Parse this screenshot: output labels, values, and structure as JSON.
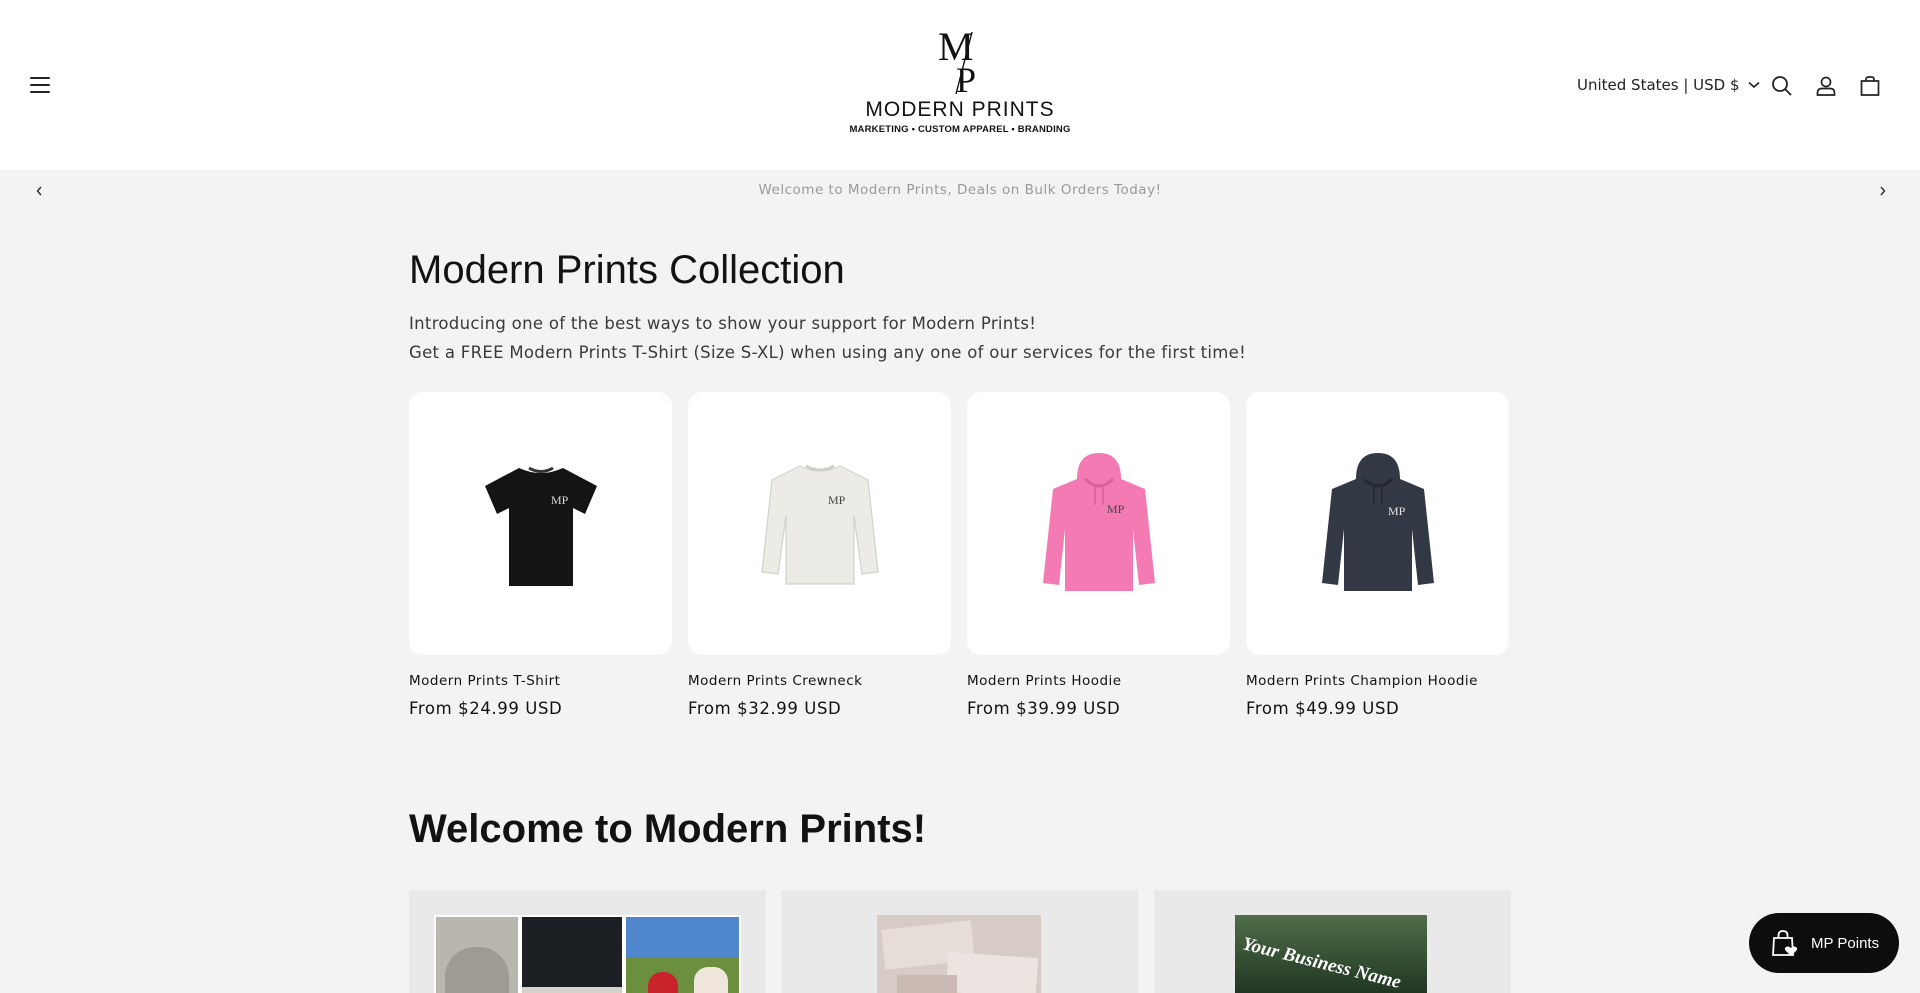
{
  "header": {
    "logo": {
      "monogram": "MP",
      "name": "MODERN PRINTS",
      "tagline": "MARKETING • CUSTOM APPAREL • BRANDING"
    },
    "locale_label": "United States | USD $",
    "icons": [
      "menu-icon",
      "chevron-down-icon",
      "search-icon",
      "account-icon",
      "cart-icon"
    ]
  },
  "announcement": {
    "text": "Welcome to Modern Prints, Deals on Bulk Orders Today!"
  },
  "collection": {
    "title": "Modern Prints Collection",
    "description_line1": "Introducing one of the best ways to show your support for Modern Prints!",
    "description_line2": "Get a FREE Modern Prints T-Shirt (Size S-XL) when using any one of our services for the first time!",
    "products": [
      {
        "name": "Modern Prints T-Shirt",
        "price": "From $24.99 USD",
        "color": "#141414"
      },
      {
        "name": "Modern Prints Crewneck",
        "price": "From $32.99 USD",
        "color": "#ecebe6"
      },
      {
        "name": "Modern Prints Hoodie",
        "price": "From $39.99 USD",
        "color": "#f37ab2"
      },
      {
        "name": "Modern Prints Champion Hoodie",
        "price": "From $49.99 USD",
        "color": "#323844"
      }
    ]
  },
  "welcome": {
    "title": "Welcome to Modern Prints!",
    "tile3_text": "Your Business Name"
  },
  "points_widget": {
    "label": "MP Points"
  }
}
